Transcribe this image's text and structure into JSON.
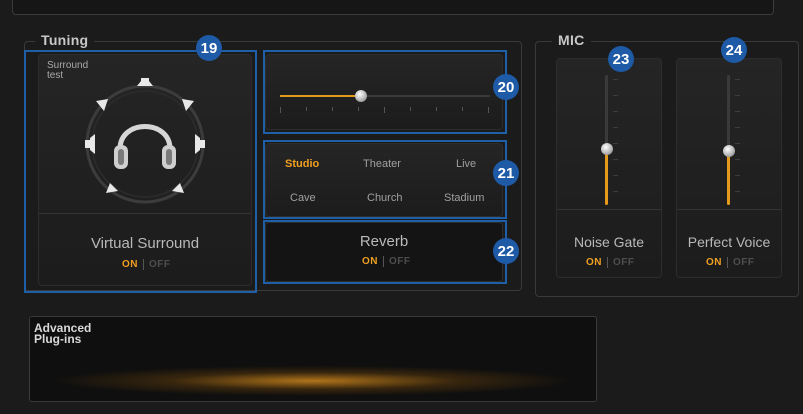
{
  "tuning": {
    "title": "Tuning",
    "virtual_surround": {
      "test_label": "Surround test",
      "label": "Virtual Surround",
      "on_label": "ON",
      "off_label": "OFF",
      "state": "on",
      "icon": "headphones-icon"
    },
    "slider": {
      "level": 0.36
    },
    "environments": {
      "items": [
        "Studio",
        "Theater",
        "Live",
        "Cave",
        "Church",
        "Stadium"
      ],
      "selected": "Studio"
    },
    "reverb": {
      "label": "Reverb",
      "on_label": "ON",
      "off_label": "OFF",
      "state": "on"
    }
  },
  "mic": {
    "title": "MIC",
    "noise_gate": {
      "label": "Noise Gate",
      "on_label": "ON",
      "off_label": "OFF",
      "state": "on",
      "level": 0.42
    },
    "perfect_voice": {
      "label": "Perfect Voice",
      "on_label": "ON",
      "off_label": "OFF",
      "state": "on",
      "level": 0.42
    }
  },
  "advanced": {
    "label_line1": "Advanced",
    "label_line2": "Plug-ins"
  },
  "callouts": [
    "19",
    "20",
    "21",
    "22",
    "23",
    "24"
  ],
  "colors": {
    "accent": "#f0a020",
    "callout": "#1e5aa6",
    "background": "#1b1b1b"
  }
}
